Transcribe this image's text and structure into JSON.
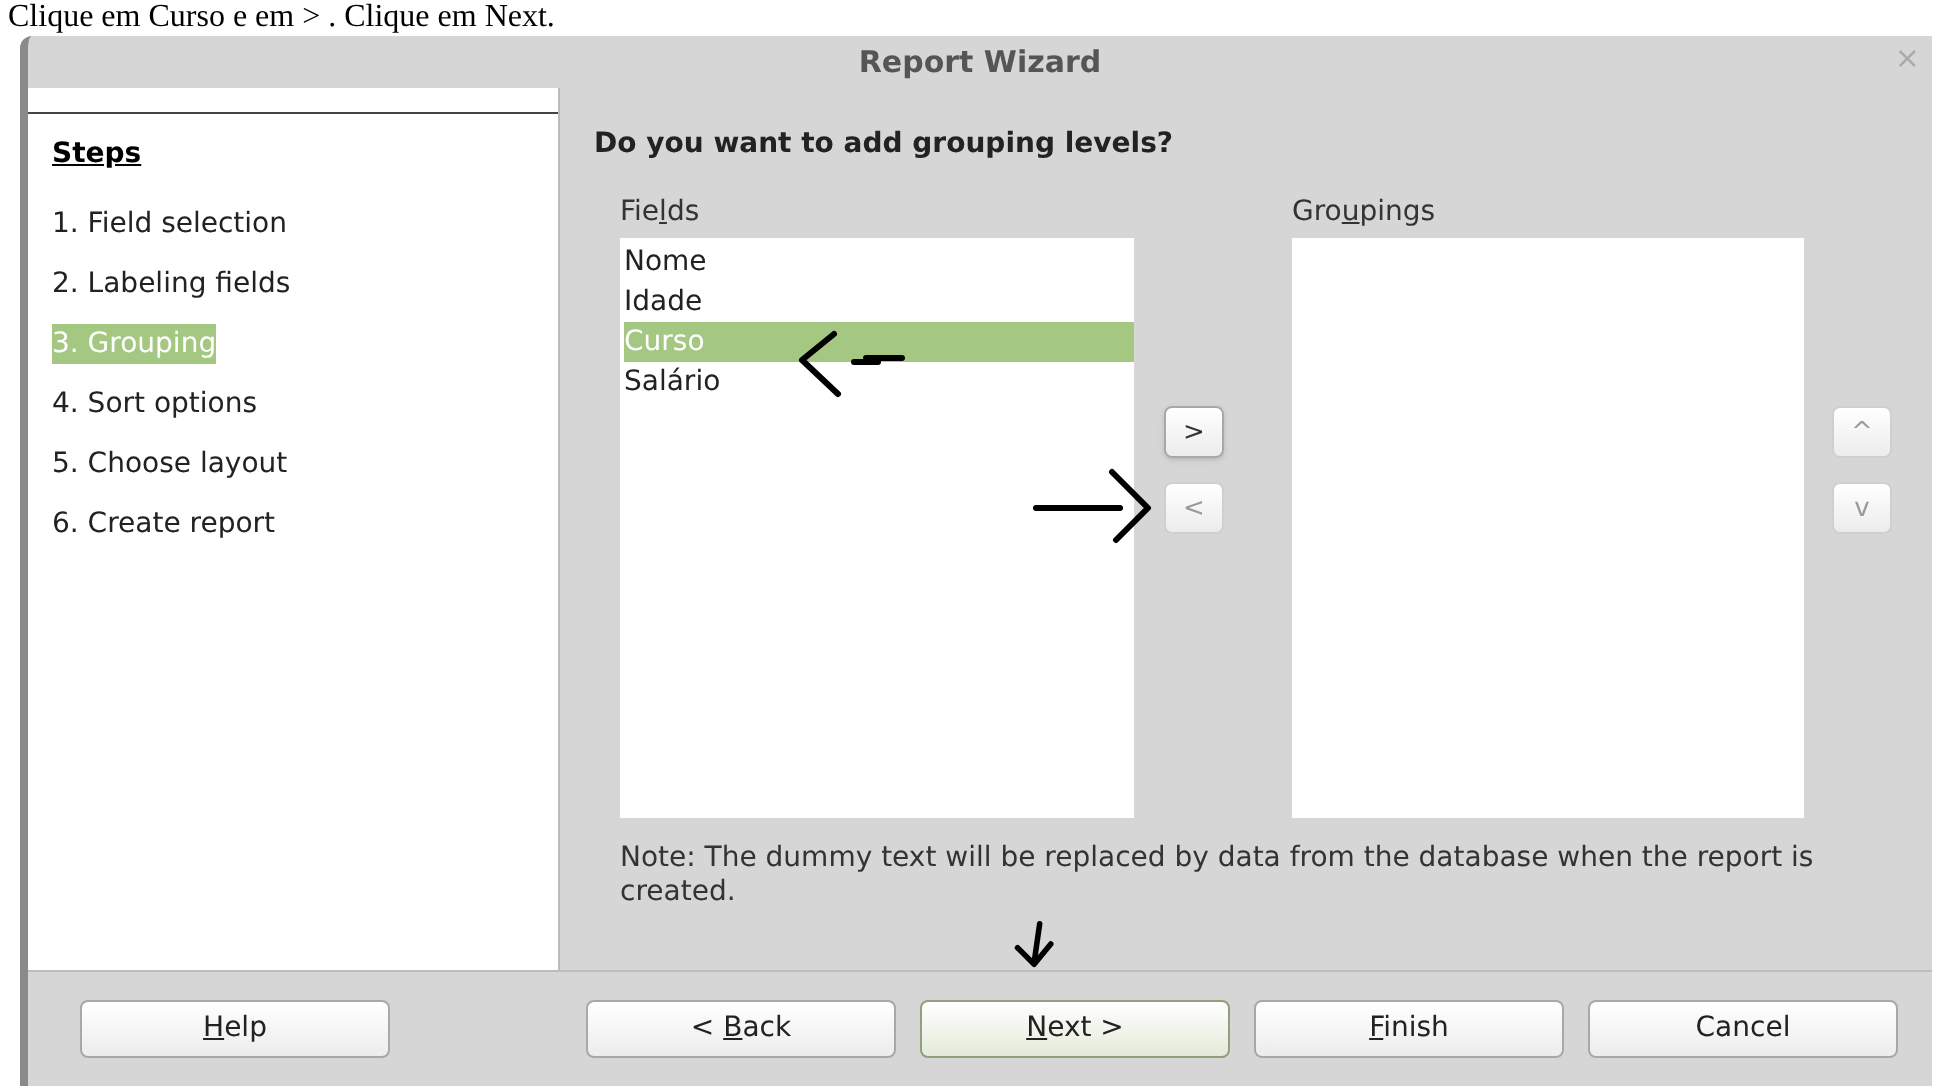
{
  "caption": "Clique em Curso e em > . Clique em Next.",
  "window": {
    "title": "Report Wizard",
    "close": "×"
  },
  "steps": {
    "title": "Steps",
    "items": [
      {
        "label": "1. Field selection",
        "selected": false
      },
      {
        "label": "2. Labeling fields",
        "selected": false
      },
      {
        "label": "3. Grouping",
        "selected": true
      },
      {
        "label": "4. Sort options",
        "selected": false
      },
      {
        "label": "5. Choose layout",
        "selected": false
      },
      {
        "label": "6. Create report",
        "selected": false
      }
    ]
  },
  "heading": "Do you want to add grouping levels?",
  "fields": {
    "label": {
      "before": "Fie",
      "key": "l",
      "after": "ds"
    },
    "items": [
      {
        "label": "Nome",
        "selected": false
      },
      {
        "label": "Idade",
        "selected": false
      },
      {
        "label": "Curso",
        "selected": true
      },
      {
        "label": "Salário",
        "selected": false
      }
    ]
  },
  "move_buttons": [
    {
      "label": ">",
      "disabled": false
    },
    {
      "label": "<",
      "disabled": true
    }
  ],
  "groupings": {
    "label": {
      "before": "Gro",
      "key": "u",
      "after": "pings"
    }
  },
  "order_buttons": [
    {
      "label": "^",
      "disabled": true
    },
    {
      "label": "v",
      "disabled": true
    }
  ],
  "note": "Note: The dummy text will be replaced by data from the database when the report is created.",
  "buttons": [
    {
      "label": {
        "key": "H",
        "after": "elp"
      },
      "default": false
    },
    {
      "label": {
        "before": "< ",
        "key": "B",
        "after": "ack"
      },
      "default": false
    },
    {
      "label": {
        "key": "N",
        "after": "ext >"
      },
      "default": true
    },
    {
      "label": {
        "key": "F",
        "after": "inish"
      },
      "default": false
    },
    {
      "label": {
        "before": "Cancel"
      },
      "default": false
    }
  ]
}
